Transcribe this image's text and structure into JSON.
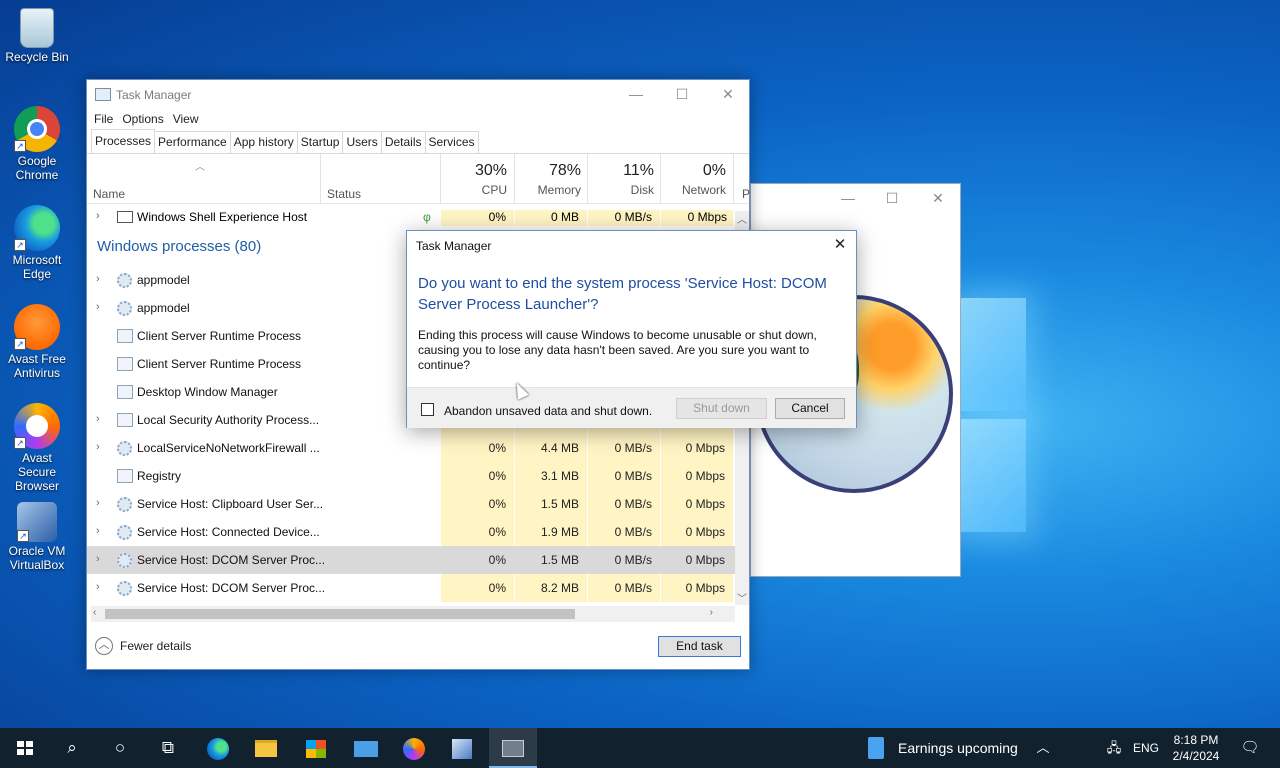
{
  "desktop": {
    "icons": [
      {
        "label": "Recycle Bin",
        "icon": "recycle-bin-icon"
      },
      {
        "label": "Google Chrome",
        "icon": "chrome-icon"
      },
      {
        "label": "Microsoft Edge",
        "icon": "edge-icon"
      },
      {
        "label": "Avast Free Antivirus",
        "icon": "avast-icon"
      },
      {
        "label": "Avast Secure Browser",
        "icon": "avast-browser-icon"
      },
      {
        "label": "Oracle VM VirtualBox",
        "icon": "virtualbox-icon"
      }
    ]
  },
  "task_manager": {
    "title": "Task Manager",
    "menu": [
      "File",
      "Options",
      "View"
    ],
    "tabs": [
      "Processes",
      "Performance",
      "App history",
      "Startup",
      "Users",
      "Details",
      "Services"
    ],
    "active_tab": "Processes",
    "columns": {
      "name": "Name",
      "status": "Status",
      "cpu": {
        "pct": "30%",
        "label": "CPU"
      },
      "memory": {
        "pct": "78%",
        "label": "Memory"
      },
      "disk": {
        "pct": "11%",
        "label": "Disk"
      },
      "network": {
        "pct": "0%",
        "label": "Network"
      },
      "power_initial": "P"
    },
    "partial_row": {
      "name": "Windows Shell Experience Host",
      "cpu": "0%",
      "memory": "0 MB",
      "disk": "0 MB/s",
      "network": "0 Mbps"
    },
    "group_header": "Windows processes (80)",
    "rows": [
      {
        "name": "appmodel",
        "expandable": true,
        "icon": "gear",
        "cpu": "",
        "memory": "",
        "disk": "",
        "network": ""
      },
      {
        "name": "appmodel",
        "expandable": true,
        "icon": "gear",
        "cpu": "",
        "memory": "",
        "disk": "",
        "network": ""
      },
      {
        "name": "Client Server Runtime Process",
        "expandable": false,
        "icon": "window",
        "cpu": "",
        "memory": "",
        "disk": "",
        "network": ""
      },
      {
        "name": "Client Server Runtime Process",
        "expandable": false,
        "icon": "window",
        "cpu": "",
        "memory": "",
        "disk": "",
        "network": ""
      },
      {
        "name": "Desktop Window Manager",
        "expandable": false,
        "icon": "window",
        "cpu": "",
        "memory": "",
        "disk": "",
        "network": ""
      },
      {
        "name": "Local Security Authority Process...",
        "expandable": true,
        "icon": "window",
        "cpu": "",
        "memory": "",
        "disk": "",
        "network": ""
      },
      {
        "name": "LocalServiceNoNetworkFirewall ...",
        "expandable": true,
        "icon": "gear",
        "cpu": "0%",
        "memory": "4.4 MB",
        "disk": "0 MB/s",
        "network": "0 Mbps"
      },
      {
        "name": "Registry",
        "expandable": false,
        "icon": "window",
        "cpu": "0%",
        "memory": "3.1 MB",
        "disk": "0 MB/s",
        "network": "0 Mbps"
      },
      {
        "name": "Service Host: Clipboard User Ser...",
        "expandable": true,
        "icon": "gear",
        "cpu": "0%",
        "memory": "1.5 MB",
        "disk": "0 MB/s",
        "network": "0 Mbps"
      },
      {
        "name": "Service Host: Connected Device...",
        "expandable": true,
        "icon": "gear",
        "cpu": "0%",
        "memory": "1.9 MB",
        "disk": "0 MB/s",
        "network": "0 Mbps"
      },
      {
        "name": "Service Host: DCOM Server Proc...",
        "expandable": true,
        "icon": "gear",
        "cpu": "0%",
        "memory": "1.5 MB",
        "disk": "0 MB/s",
        "network": "0 Mbps",
        "selected": true
      },
      {
        "name": "Service Host: DCOM Server Proc...",
        "expandable": true,
        "icon": "gear",
        "cpu": "0%",
        "memory": "8.2 MB",
        "disk": "0 MB/s",
        "network": "0 Mbps"
      }
    ],
    "fewer_details": "Fewer details",
    "end_task": "End task"
  },
  "dialog": {
    "title": "Task Manager",
    "heading": "Do you want to end the system process 'Service Host: DCOM Server Process Launcher'?",
    "body": "Ending this process will cause Windows to become unusable or shut down, causing you to lose any data hasn't been saved. Are you sure you want to continue?",
    "checkbox_label": "Abandon unsaved data and shut down.",
    "checkbox_checked": false,
    "shutdown_label": "Shut down",
    "cancel_label": "Cancel"
  },
  "taskbar": {
    "pinned": [
      "search-icon",
      "cortana-icon",
      "task-view-icon",
      "edge-icon",
      "file-explorer-icon",
      "store-icon",
      "mail-icon",
      "avast-browser-icon",
      "virtualbox-icon",
      "task-manager-icon"
    ],
    "news": "Earnings upcoming",
    "language": "ENG",
    "time": "8:18 PM",
    "date": "2/4/2024"
  },
  "colors": {
    "accent": "#1f4ea0",
    "usage_highlight": "#fff4c4",
    "taskbar": "#12212e"
  }
}
